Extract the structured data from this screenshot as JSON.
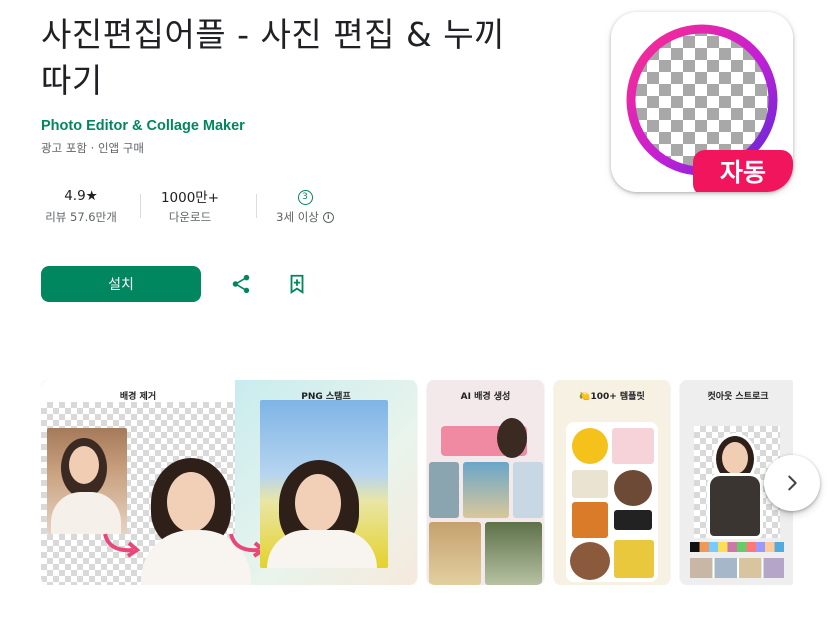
{
  "app": {
    "title": "사진편집어플 - 사진 편집 & 누끼따기",
    "developer": "Photo Editor & Collage Maker",
    "ads_note": "광고 포함 · 인앱 구매",
    "icon_badge": "자동"
  },
  "stats": {
    "rating_value": "4.9★",
    "rating_label": "리뷰 57.6만개",
    "downloads_value": "1000만+",
    "downloads_label": "다운로드",
    "age_badge": "3",
    "age_label": "3세 이상"
  },
  "actions": {
    "install_label": "설치"
  },
  "screenshots": [
    {
      "caption_left": "배경 제거",
      "caption_right": "PNG 스탬프"
    },
    {
      "caption": "AI 배경 생성"
    },
    {
      "caption": "🍋100+ 템플릿"
    },
    {
      "caption": "컷아웃 스트로크"
    }
  ],
  "colors": {
    "brand_green": "#01875f",
    "icon_ring_start": "#ff2d8a",
    "icon_ring_end": "#5b2bd8",
    "badge_pink": "#f0155d"
  },
  "icons": [
    "share-icon",
    "wishlist-icon",
    "info-icon",
    "chevron-right-icon"
  ]
}
